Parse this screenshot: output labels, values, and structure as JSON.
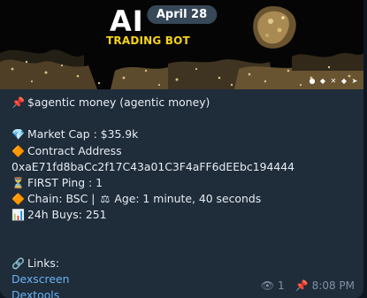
{
  "banner": {
    "date": "April 28",
    "logo_ai": "AI",
    "logo_sub": "TRADING BOT"
  },
  "message": {
    "title_icon": "pushpin-icon",
    "title": "$agentic money (agentic money)",
    "market_cap_icon": "gem-icon",
    "market_cap": "Market Cap : $35.9k",
    "contract_label_icon": "orange-diamond-icon",
    "contract_label": "Contract Address",
    "contract_address": "0xaE71fd8baCc2f17C43a01C3F4aFF6dEEbc194444",
    "first_ping_icon": "hourglass-icon",
    "first_ping": "FIRST Ping :  1",
    "chain_icon": "orange-diamond-icon",
    "chain": "Chain: BSC | ",
    "age_icon": "scales-icon",
    "age": "Age: 1 minute, 40 seconds",
    "buys_icon": "bar-chart-icon",
    "buys": "24h Buys: 251",
    "links_icon": "link-icon",
    "links_label": "Links:",
    "link1": "Dexscreen",
    "link2": "Dextools"
  },
  "meta": {
    "views": "1",
    "time": "8:08 PM"
  },
  "colors": {
    "bubble": "#1f2c3a",
    "link": "#6ab3f3",
    "accent_yellow": "#f5d21a"
  }
}
